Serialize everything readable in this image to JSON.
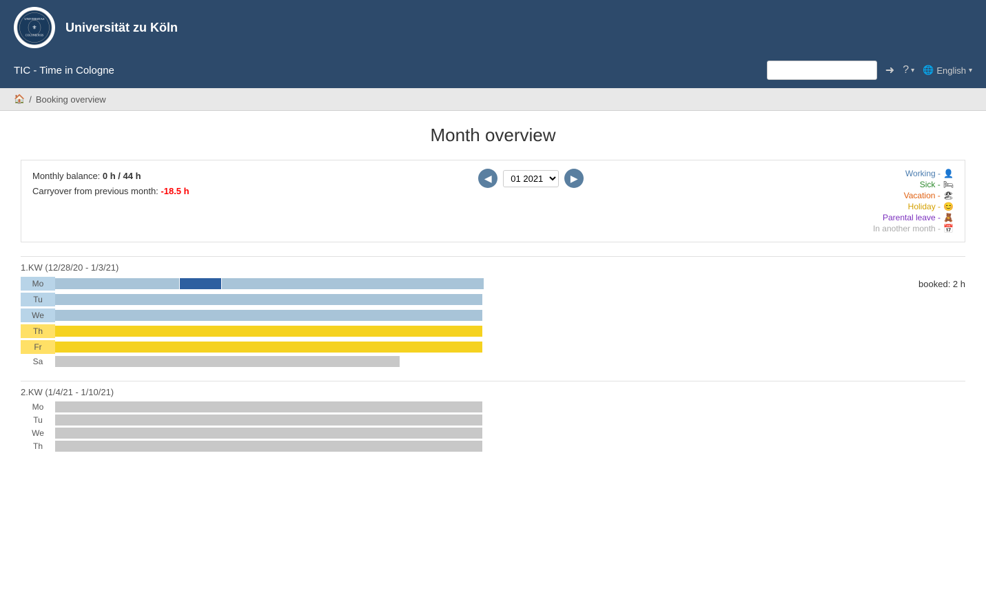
{
  "header": {
    "university_name": "Universität zu Köln",
    "app_title": "TIC - Time in Cologne",
    "search_placeholder": "",
    "language": "English"
  },
  "breadcrumb": {
    "home_icon": "🏠",
    "separator": "/",
    "current": "Booking overview"
  },
  "page": {
    "title": "Month overview"
  },
  "month_controls": {
    "monthly_balance_label": "Monthly balance:",
    "monthly_balance_value": "0 h / 44 h",
    "carryover_label": "Carryover from previous month:",
    "carryover_value": "-18.5 h",
    "current_month": "01 2021",
    "prev_btn": "◀",
    "next_btn": "▶"
  },
  "legend": {
    "working_label": "Working - ",
    "sick_label": "Sick - ",
    "vacation_label": "Vacation - ",
    "holiday_label": "Holiday - ",
    "parental_label": "Parental leave - ",
    "other_label": "In another month - "
  },
  "weeks": [
    {
      "header": "1.KW (12/28/20 - 1/3/21)",
      "booked": "booked: 2 h",
      "days": [
        {
          "label": "Mo",
          "type": "working",
          "has_dark": true
        },
        {
          "label": "Tu",
          "type": "working",
          "has_dark": false
        },
        {
          "label": "We",
          "type": "working",
          "has_dark": false
        },
        {
          "label": "Th",
          "type": "holiday",
          "has_dark": false
        },
        {
          "label": "Fr",
          "type": "holiday",
          "has_dark": false
        },
        {
          "label": "Sa",
          "type": "gray",
          "has_dark": false
        }
      ]
    },
    {
      "header": "2.KW (1/4/21 - 1/10/21)",
      "booked": "",
      "days": [
        {
          "label": "Mo",
          "type": "gray",
          "has_dark": false
        },
        {
          "label": "Tu",
          "type": "gray",
          "has_dark": false
        },
        {
          "label": "We",
          "type": "gray",
          "has_dark": false
        },
        {
          "label": "Th",
          "type": "gray",
          "has_dark": false
        }
      ]
    }
  ]
}
